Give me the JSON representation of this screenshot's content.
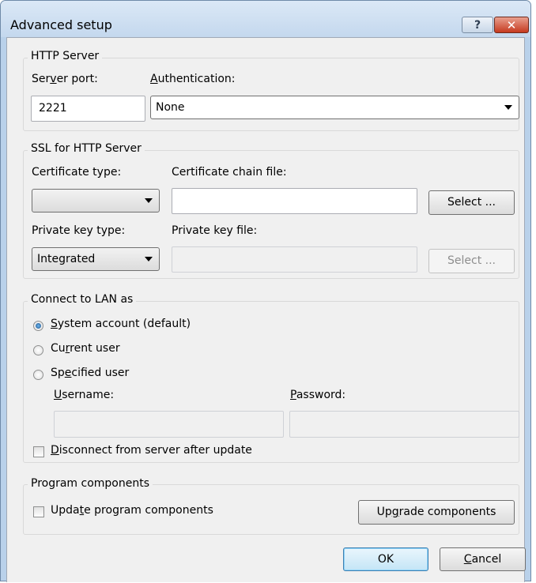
{
  "window": {
    "title": "Advanced setup",
    "help_icon": "?",
    "close_icon": "✕"
  },
  "http_server": {
    "group_label": "HTTP Server",
    "port_label_pre": "Ser",
    "port_label_u": "v",
    "port_label_post": "er port:",
    "port_value": "2221",
    "auth_label_u": "A",
    "auth_label_post": "uthentication:",
    "auth_value": "None"
  },
  "ssl": {
    "group_label": "SSL for HTTP Server",
    "cert_type_label": "Certificate type:",
    "cert_type_value": "",
    "cert_chain_label": "Certificate chain file:",
    "cert_chain_value": "",
    "select_label": "Select ...",
    "private_key_type_label": "Private key type:",
    "private_key_type_value": "Integrated",
    "private_key_file_label": "Private key file:",
    "private_key_file_value": "",
    "select2_label": "Select ..."
  },
  "lan": {
    "group_label": "Connect to LAN as",
    "system_u": "S",
    "system_post": "ystem account (default)",
    "current_pre": "Cu",
    "current_u": "r",
    "current_post": "rent user",
    "specified_pre": "Sp",
    "specified_u": "e",
    "specified_post": "cified user",
    "username_u": "U",
    "username_post": "sername:",
    "password_u": "P",
    "password_post": "assword:",
    "username_value": "",
    "password_value": "",
    "disconnect_u": "D",
    "disconnect_post": "isconnect from server after update"
  },
  "components": {
    "group_label": "Program components",
    "update_pre": "Upda",
    "update_u": "t",
    "update_post": "e program components",
    "upgrade_pre": "Up",
    "upgrade_u": "g",
    "upgrade_post": "rade components"
  },
  "footer": {
    "ok_label": "OK",
    "cancel_u": "C",
    "cancel_post": "ancel"
  }
}
